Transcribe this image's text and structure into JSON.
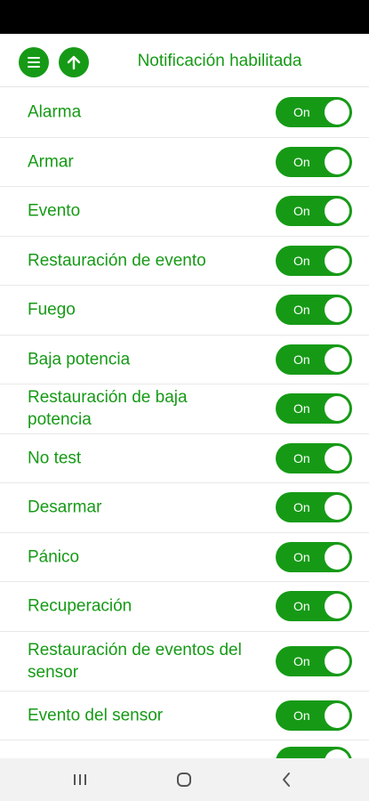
{
  "header": {
    "title": "Notificación habilitada",
    "menu_icon": "menu-icon",
    "up_icon": "arrow-up-icon"
  },
  "colors": {
    "accent": "#169a16",
    "nav_bg": "#f2f2f2"
  },
  "notifications": [
    {
      "label": "Alarma",
      "state": "On"
    },
    {
      "label": "Armar",
      "state": "On"
    },
    {
      "label": "Evento",
      "state": "On"
    },
    {
      "label": "Restauración de evento",
      "state": "On"
    },
    {
      "label": "Fuego",
      "state": "On"
    },
    {
      "label": "Baja potencia",
      "state": "On"
    },
    {
      "label": "Restauración de baja potencia",
      "state": "On"
    },
    {
      "label": "No test",
      "state": "On"
    },
    {
      "label": "Desarmar",
      "state": "On"
    },
    {
      "label": "Pánico",
      "state": "On"
    },
    {
      "label": "Recuperación",
      "state": "On"
    },
    {
      "label": "Restauración de eventos del sensor",
      "state": "On"
    },
    {
      "label": "Evento del sensor",
      "state": "On"
    }
  ],
  "nav": {
    "recents_icon": "recent-apps-icon",
    "home_icon": "home-icon",
    "back_icon": "back-icon"
  }
}
